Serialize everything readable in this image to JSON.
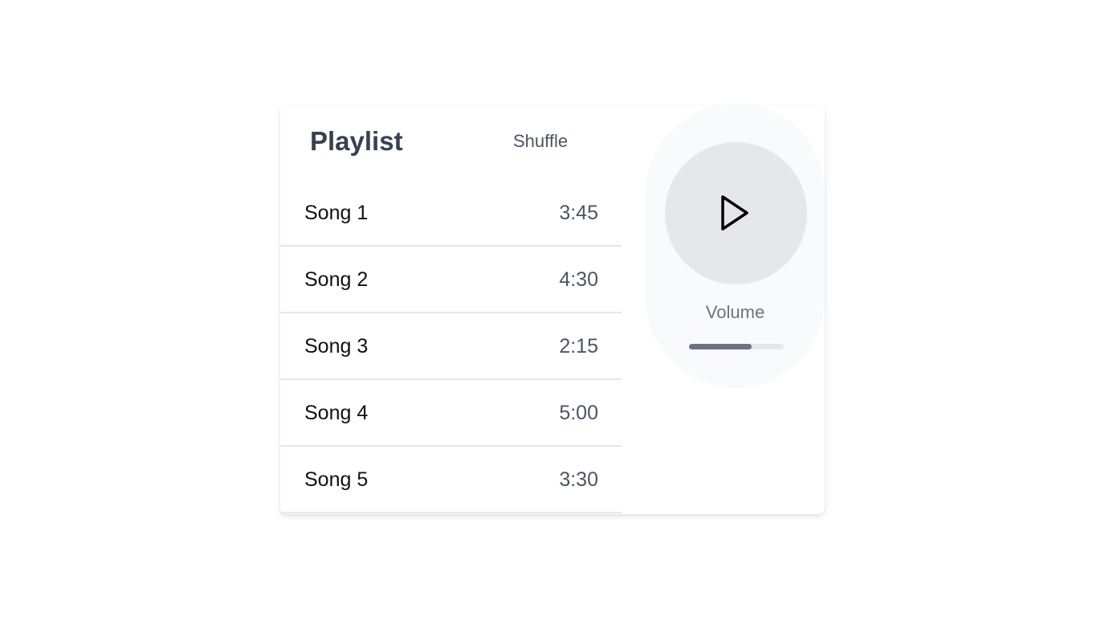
{
  "playlist": {
    "title": "Playlist",
    "shuffle_label": "Shuffle",
    "songs": [
      {
        "title": "Song 1",
        "duration": "3:45"
      },
      {
        "title": "Song 2",
        "duration": "4:30"
      },
      {
        "title": "Song 3",
        "duration": "2:15"
      },
      {
        "title": "Song 4",
        "duration": "5:00"
      },
      {
        "title": "Song 5",
        "duration": "3:30"
      }
    ]
  },
  "player": {
    "play_icon": "play-icon",
    "volume_label": "Volume",
    "volume_level": 0.66
  },
  "colors": {
    "title": "#374151",
    "secondary_text": "#4b5563",
    "play_button_bg": "#e5e7eb",
    "player_panel_bg": "#f9fafb",
    "volume_fill": "#6b7280"
  }
}
